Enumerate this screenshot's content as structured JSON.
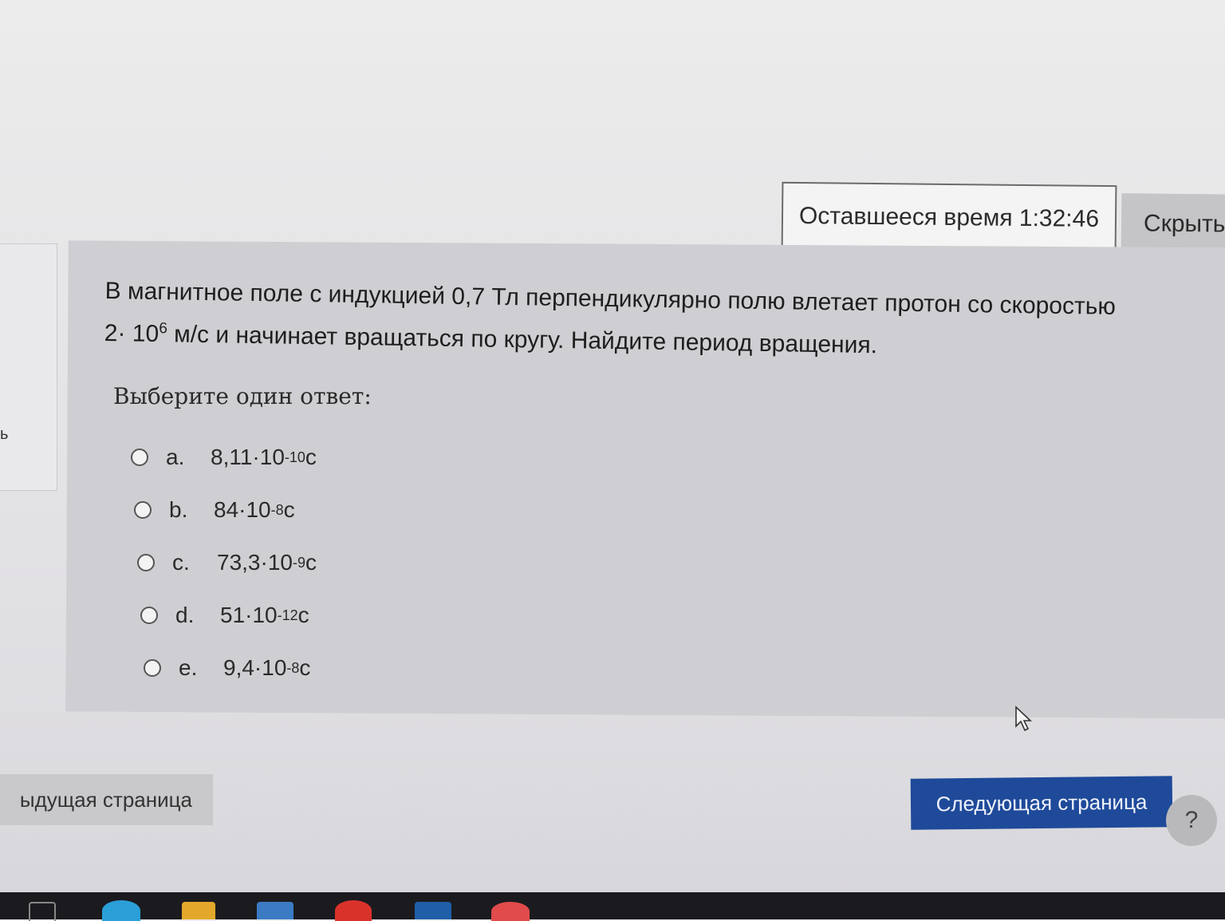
{
  "timer": {
    "label": "Оставшееся время 1:32:46"
  },
  "hide_button": {
    "label": "Скрыть"
  },
  "left_strip_char": "ь",
  "question": {
    "line1": "В магнитное поле с индукцией 0,7 Тл перпендикулярно полю влетает протон со скоростью",
    "speed_base": "2· 10",
    "speed_exp": "6",
    "line2_rest": " м/с  и начинает вращаться по кругу. Найдите период вращения."
  },
  "prompt": "Выберите один ответ:",
  "answers": [
    {
      "letter": "a.",
      "mantissa": "8,11·10",
      "exp": "-10",
      "unit": " с"
    },
    {
      "letter": "b.",
      "mantissa": "84·10",
      "exp": "-8",
      "unit": " с"
    },
    {
      "letter": "c.",
      "mantissa": "73,3·10",
      "exp": "-9",
      "unit": " с"
    },
    {
      "letter": "d.",
      "mantissa": "51·10",
      "exp": "-12",
      "unit": " с"
    },
    {
      "letter": "e.",
      "mantissa": "9,4·10",
      "exp": "-8",
      "unit": " с"
    }
  ],
  "nav": {
    "prev_label": "ыдущая страница",
    "next_label": "Следующая страница",
    "help_label": "?"
  },
  "colors": {
    "next_button": "#1f4a9a",
    "card": "#cfcfd3",
    "taskbar": "#1b1b1f"
  }
}
